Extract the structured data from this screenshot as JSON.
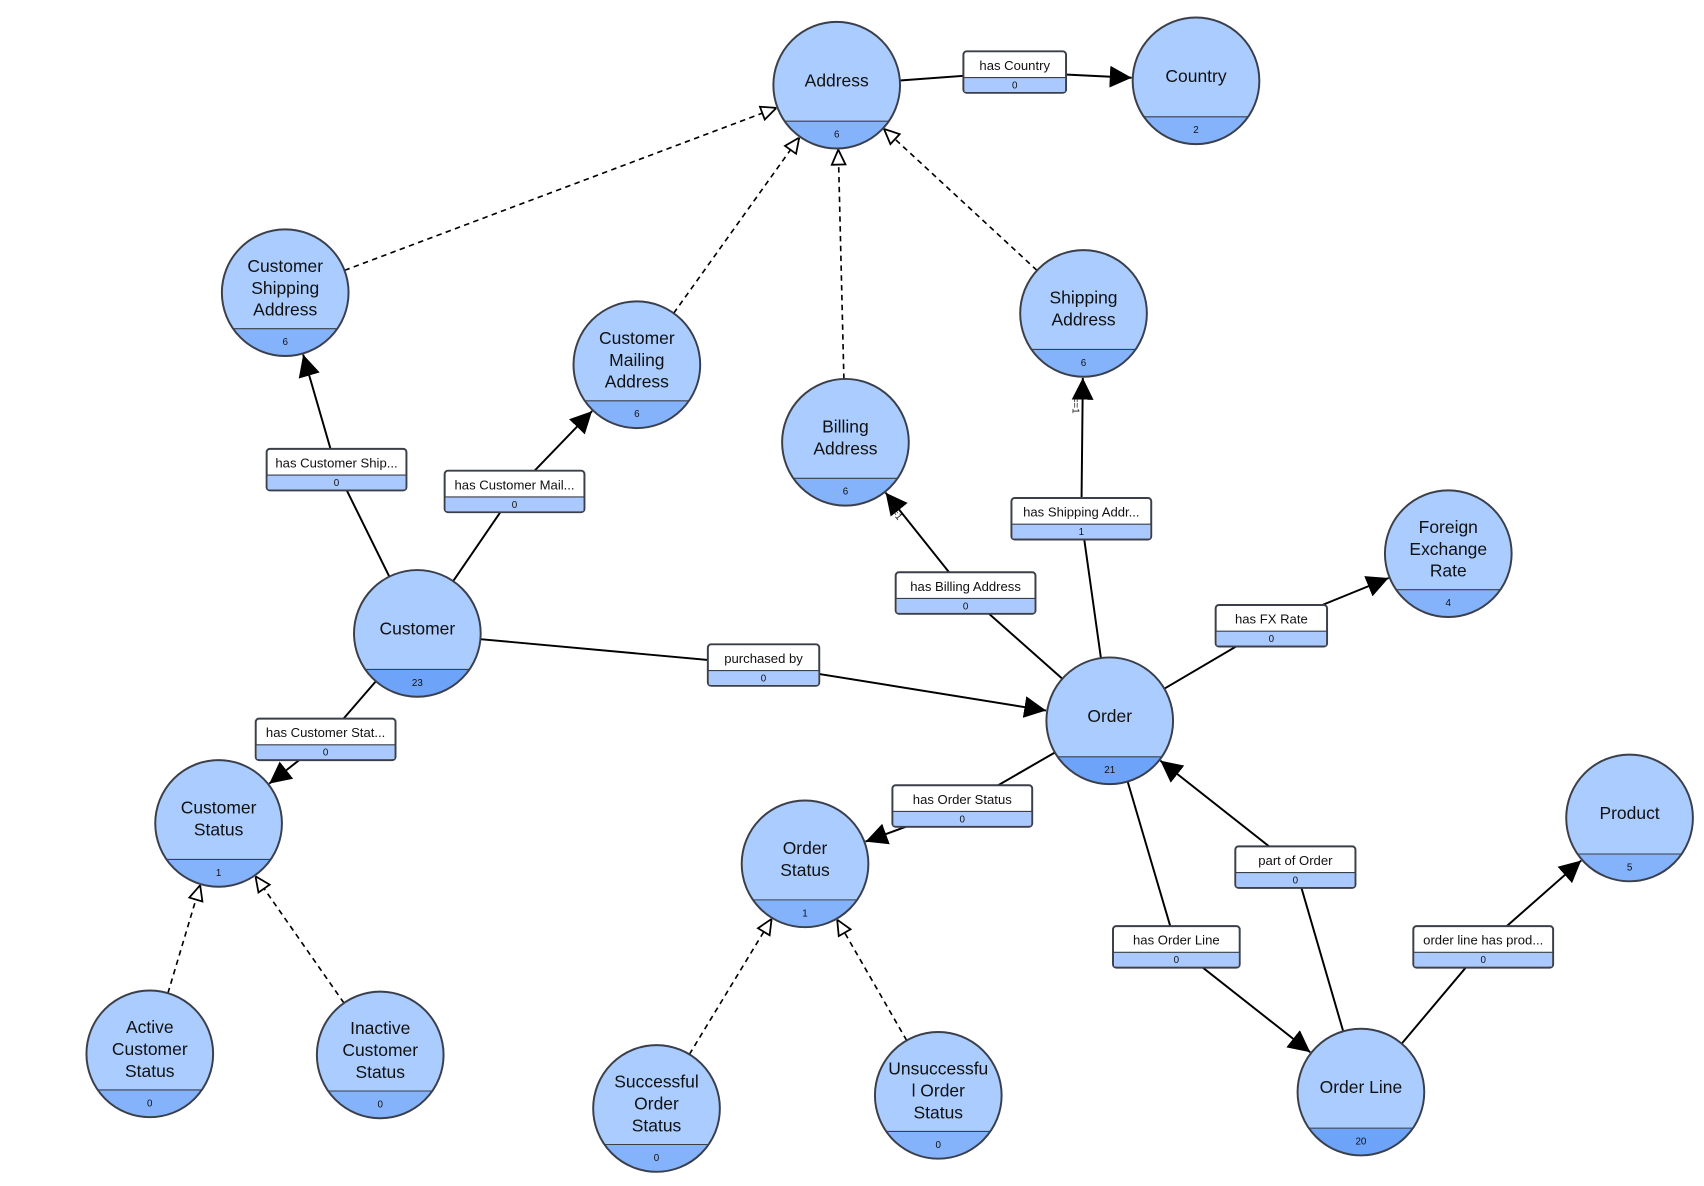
{
  "colors": {
    "node_fill": "#aaccff",
    "node_band": "#84b2fb",
    "node_band_dark": "#6da3f8",
    "stroke": "#3a3f4a",
    "label_band": "#a9c9ff"
  },
  "nodes": [
    {
      "id": "address",
      "lines": [
        "Address"
      ],
      "count": "6"
    },
    {
      "id": "country",
      "lines": [
        "Country"
      ],
      "count": "2"
    },
    {
      "id": "customer-shipping-address",
      "lines": [
        "Customer",
        "Shipping",
        "Address"
      ],
      "count": "6"
    },
    {
      "id": "customer-mailing-address",
      "lines": [
        "Customer",
        "Mailing",
        "Address"
      ],
      "count": "6"
    },
    {
      "id": "billing-address",
      "lines": [
        "Billing",
        "Address"
      ],
      "count": "6"
    },
    {
      "id": "shipping-address",
      "lines": [
        "Shipping",
        "Address"
      ],
      "count": "6"
    },
    {
      "id": "foreign-exchange-rate",
      "lines": [
        "Foreign",
        "Exchange",
        "Rate"
      ],
      "count": "4"
    },
    {
      "id": "customer",
      "lines": [
        "Customer"
      ],
      "count": "23",
      "emphasis": true
    },
    {
      "id": "order",
      "lines": [
        "Order"
      ],
      "count": "21",
      "emphasis": true
    },
    {
      "id": "customer-status",
      "lines": [
        "Customer",
        "Status"
      ],
      "count": "1"
    },
    {
      "id": "order-status",
      "lines": [
        "Order",
        "Status"
      ],
      "count": "1"
    },
    {
      "id": "product",
      "lines": [
        "Product"
      ],
      "count": "5"
    },
    {
      "id": "active-customer-status",
      "lines": [
        "Active",
        "Customer",
        "Status"
      ],
      "count": "0"
    },
    {
      "id": "inactive-customer-status",
      "lines": [
        "Inactive",
        "Customer",
        "Status"
      ],
      "count": "0"
    },
    {
      "id": "successful-order-status",
      "lines": [
        "Successful",
        "Order",
        "Status"
      ],
      "count": "0"
    },
    {
      "id": "unsuccessful-order-status",
      "lines": [
        "Unsuccessfu",
        "l Order",
        "Status"
      ],
      "count": "0"
    },
    {
      "id": "order-line",
      "lines": [
        "Order Line"
      ],
      "count": "20",
      "emphasis": true
    }
  ],
  "relations": [
    {
      "from": "address",
      "to": "country",
      "label": "has Country",
      "count": "0"
    },
    {
      "from": "customer",
      "to": "customer-shipping-address",
      "label": "has Customer Ship...",
      "count": "0"
    },
    {
      "from": "customer",
      "to": "customer-mailing-address",
      "label": "has Customer Mail...",
      "count": "0"
    },
    {
      "from": "order",
      "to": "billing-address",
      "label": "has Billing Address",
      "count": "0",
      "cardinality": "==1"
    },
    {
      "from": "order",
      "to": "shipping-address",
      "label": "has Shipping Addr...",
      "count": "1",
      "cardinality": "==1"
    },
    {
      "from": "order",
      "to": "foreign-exchange-rate",
      "label": "has FX Rate",
      "count": "0"
    },
    {
      "from": "customer",
      "to": "order",
      "label": "purchased by",
      "count": "0"
    },
    {
      "from": "customer",
      "to": "customer-status",
      "label": "has Customer Stat...",
      "count": "0"
    },
    {
      "from": "order",
      "to": "order-status",
      "label": "has Order Status",
      "count": "0"
    },
    {
      "from": "order-line",
      "to": "order",
      "label": "part of Order",
      "count": "0"
    },
    {
      "from": "order",
      "to": "order-line",
      "label": "has Order Line",
      "count": "0"
    },
    {
      "from": "order-line",
      "to": "product",
      "label": "order line has prod...",
      "count": "0"
    }
  ],
  "inheritance": [
    {
      "from": "customer-shipping-address",
      "to": "address"
    },
    {
      "from": "customer-mailing-address",
      "to": "address"
    },
    {
      "from": "billing-address",
      "to": "address"
    },
    {
      "from": "shipping-address",
      "to": "address"
    },
    {
      "from": "active-customer-status",
      "to": "customer-status"
    },
    {
      "from": "inactive-customer-status",
      "to": "customer-status"
    },
    {
      "from": "successful-order-status",
      "to": "order-status"
    },
    {
      "from": "unsuccessful-order-status",
      "to": "order-status"
    }
  ]
}
